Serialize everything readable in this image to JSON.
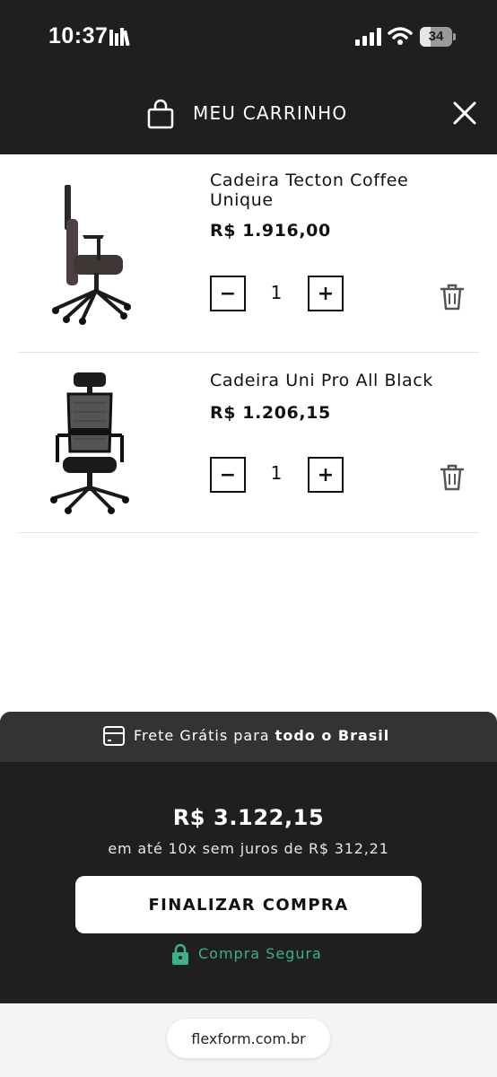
{
  "status_bar": {
    "time": "10:37",
    "battery_level": "34",
    "battery_fraction": 0.34
  },
  "header": {
    "title": "MEU CARRINHO",
    "icons": [
      "shopping-bag-icon",
      "close-icon"
    ]
  },
  "cart_items": [
    {
      "name": "Cadeira Tecton Coffee Unique",
      "price": "R$ 1.916,00",
      "quantity": "1",
      "minus_label": "−",
      "plus_label": "+"
    },
    {
      "name": "Cadeira Uni Pro All Black",
      "price": "R$ 1.206,15",
      "quantity": "1",
      "minus_label": "−",
      "plus_label": "+"
    }
  ],
  "summary": {
    "shipping_prefix": "Frete Grátis para",
    "shipping_bold": "todo o Brasil",
    "total": "R$ 3.122,15",
    "installments": "em até 10x sem juros de R$ 312,21",
    "checkout_label": "FINALIZAR COMPRA",
    "secure_label": "Compra Segura"
  },
  "browser": {
    "url": "flexform.com.br"
  },
  "colors": {
    "dark_bg": "#1f1f1f",
    "shipping_bg": "#333333",
    "secure_green": "#3fae8a"
  }
}
